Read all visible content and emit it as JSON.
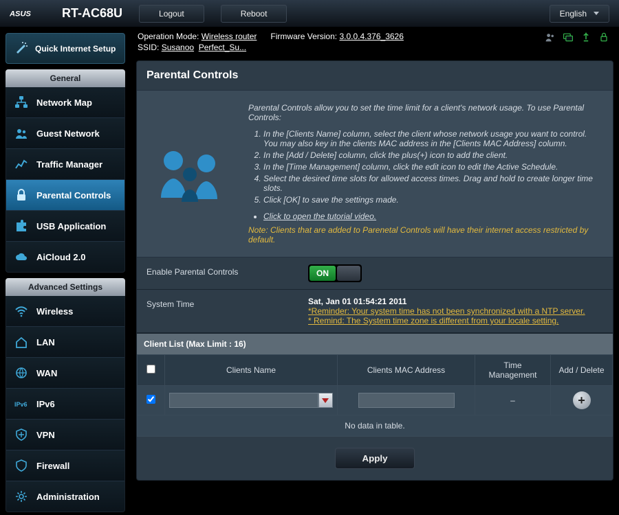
{
  "header": {
    "brand": "ASUS",
    "model": "RT-AC68U",
    "logout": "Logout",
    "reboot": "Reboot",
    "language": "English"
  },
  "info": {
    "opmode_label": "Operation Mode:",
    "opmode_value": "Wireless router",
    "fw_label": "Firmware Version:",
    "fw_value": "3.0.0.4.376_3626",
    "ssid_label": "SSID:",
    "ssid_1": "Susanoo",
    "ssid_2": "Perfect_Su..."
  },
  "sidebar": {
    "qis": "Quick Internet Setup",
    "general_label": "General",
    "general": [
      "Network Map",
      "Guest Network",
      "Traffic Manager",
      "Parental Controls",
      "USB Application",
      "AiCloud 2.0"
    ],
    "advanced_label": "Advanced Settings",
    "advanced": [
      "Wireless",
      "LAN",
      "WAN",
      "IPv6",
      "VPN",
      "Firewall",
      "Administration"
    ]
  },
  "page": {
    "title": "Parental Controls",
    "intro_lead": "Parental Controls allow you to set the time limit for a client's network usage. To use Parental Controls:",
    "steps": [
      "In the [Clients Name] column, select the client whose network usage you want to control. You may also key in the clients MAC address in the [Clients MAC Address] column.",
      "In the [Add / Delete] column, click the plus(+) icon to add the client.",
      "In the [Time Management] column, click the edit icon to edit the Active Schedule.",
      "Select the desired time slots for allowed access times. Drag and hold to create longer time slots.",
      "Click [OK] to save the settings made."
    ],
    "tutorial_link": "Click to open the tutorial video.",
    "note": "Note: Clients that are added to Parenetal Controls will have their internet access restricted by default.",
    "enable_label": "Enable Parental Controls",
    "toggle_on": "ON",
    "systime_label": "System Time",
    "systime_value": "Sat, Jan 01 01:54:21 2011",
    "systime_warn1": "*Reminder: Your system time has not been synchronized with a NTP server.",
    "systime_warn2": "* Remind: The System time zone is different from your locale setting.",
    "client_list_header": "Client List (Max Limit : 16)",
    "cols": {
      "check": "",
      "name": "Clients Name",
      "mac": "Clients MAC Address",
      "time": "Time Management",
      "add": "Add / Delete"
    },
    "row_time_placeholder": "–",
    "nodata": "No data in table.",
    "apply": "Apply"
  }
}
